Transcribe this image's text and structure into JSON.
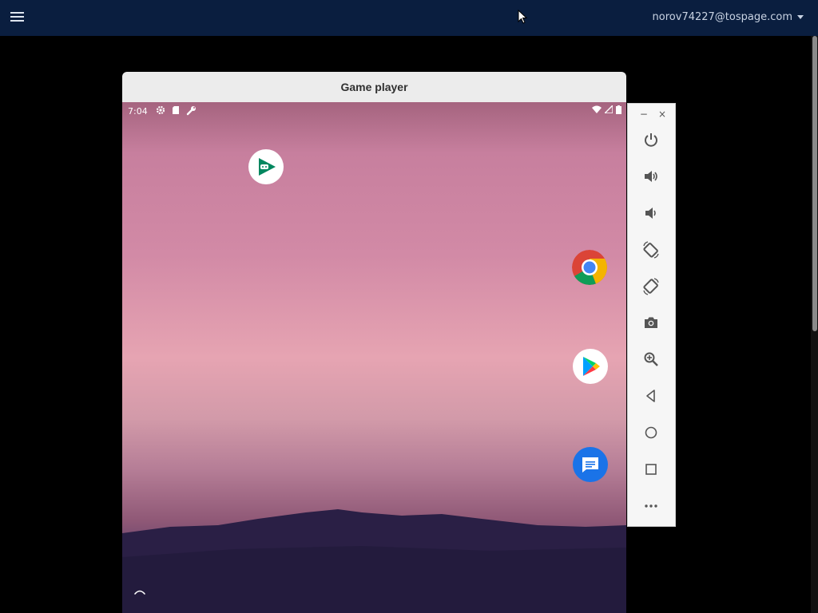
{
  "topbar": {
    "user_email": "norov74227@tospage.com"
  },
  "window": {
    "title": "Game player"
  },
  "statusbar": {
    "time": "7:04"
  },
  "home_screen": {
    "apps": [
      {
        "name": "Google Play Games",
        "icon": "play-games-icon"
      },
      {
        "name": "Chrome",
        "icon": "chrome-icon"
      },
      {
        "name": "Google Play Store",
        "icon": "play-store-icon"
      },
      {
        "name": "Messages",
        "icon": "messages-icon"
      }
    ]
  },
  "emulator_toolbar": {
    "minimize": "−",
    "close": "×",
    "buttons": [
      "power-icon",
      "volume-up-icon",
      "volume-down-icon",
      "rotate-left-icon",
      "rotate-right-icon",
      "camera-icon",
      "zoom-icon",
      "back-icon",
      "home-icon",
      "overview-icon",
      "more-icon"
    ]
  },
  "colors": {
    "topbar_bg": "#0a1e3f",
    "toolbar_icon": "#555555",
    "chrome_red": "#db4437",
    "chrome_green": "#0f9d58",
    "chrome_yellow": "#f4b400",
    "chrome_blue": "#4285f4",
    "messages_blue": "#1a73e8"
  }
}
